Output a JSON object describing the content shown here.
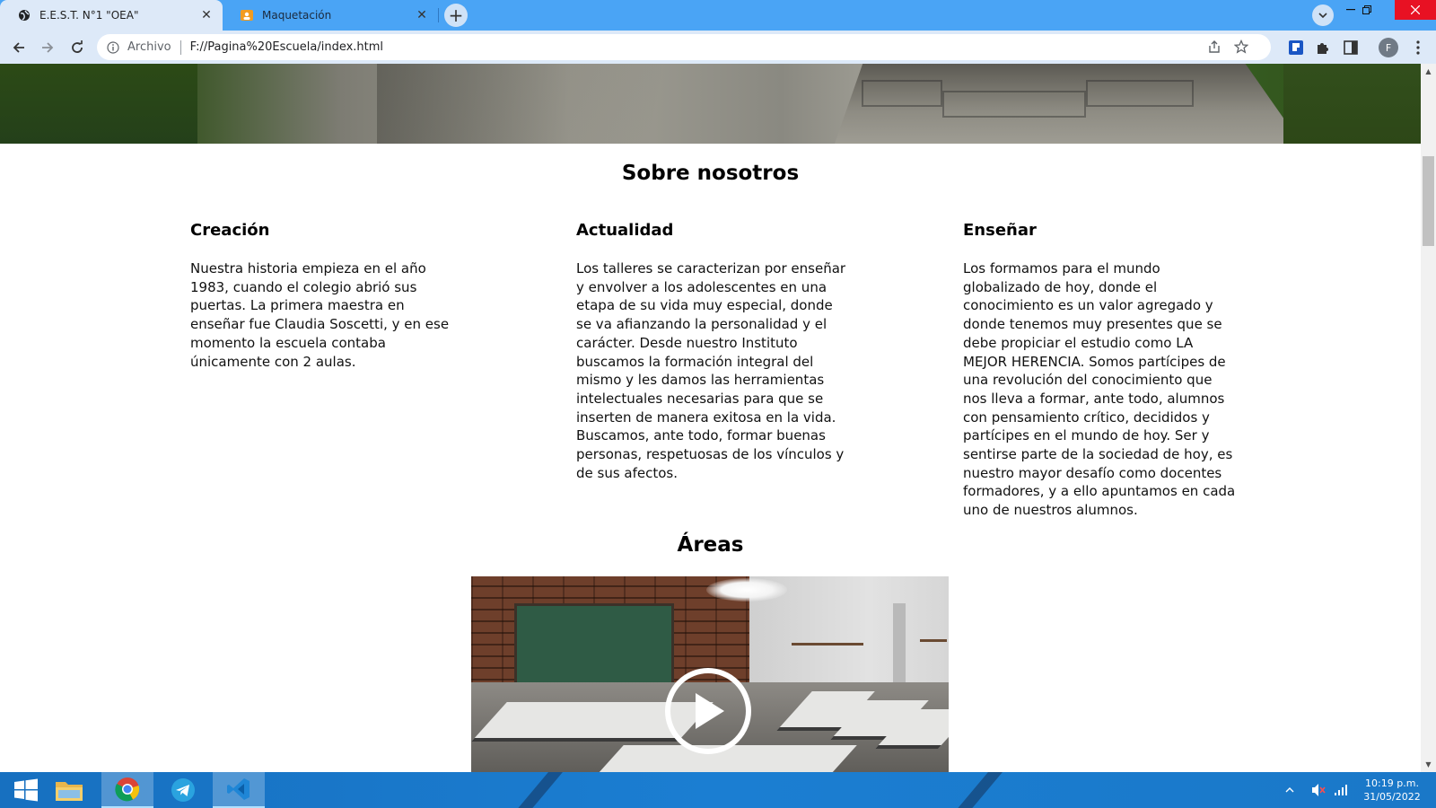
{
  "browser": {
    "tabs": [
      {
        "title": "E.E.S.T. N°1 \"OEA\"",
        "active": true
      },
      {
        "title": "Maquetación",
        "active": false
      }
    ],
    "omnibox": {
      "scheme_label": "Archivo",
      "url": "F://Pagina%20Escuela/index.html"
    },
    "profile_initial": "F"
  },
  "page": {
    "about": {
      "title": "Sobre nosotros",
      "columns": [
        {
          "heading": "Creación",
          "text": "Nuestra historia empieza en el año 1983, cuando el colegio abrió sus puertas. La primera maestra en enseñar fue Claudia Soscetti, y en ese momento la escuela contaba únicamente con 2 aulas."
        },
        {
          "heading": "Actualidad",
          "text": "Los talleres se caracterizan por enseñar y envolver a los adolescentes en una etapa de su vida muy especial, donde se va afianzando la personalidad y el carácter. Desde nuestro Instituto buscamos la formación integral del mismo y les damos las herramientas intelectuales necesarias para que se inserten de manera exitosa en la vida. Buscamos, ante todo, formar buenas personas, respetuosas de los vínculos y de sus afectos."
        },
        {
          "heading": "Enseñar",
          "text": "Los formamos para el mundo globalizado de hoy, donde el conocimiento es un valor agregado y donde tenemos muy presentes que se debe propiciar el estudio como LA MEJOR HERENCIA. Somos partícipes de una revolución del conocimiento que nos lleva a formar, ante todo, alumnos con pensamiento crítico, decididos y partícipes en el mundo de hoy. Ser y sentirse parte de la sociedad de hoy, es nuestro mayor desafío como docentes formadores, y a ello apuntamos en cada uno de nuestros alumnos."
        }
      ]
    },
    "areas": {
      "title": "Áreas"
    }
  },
  "taskbar": {
    "apps": [
      "windows-start",
      "file-explorer",
      "chrome",
      "telegram",
      "vscode"
    ],
    "clock": {
      "time": "10:19 p.m.",
      "date": "31/05/2022"
    }
  },
  "colors": {
    "tabstrip": "#4aa4f5",
    "toolbar": "#dde9f8",
    "taskbar": "#1b7ed2",
    "close_button": "#e81123"
  }
}
